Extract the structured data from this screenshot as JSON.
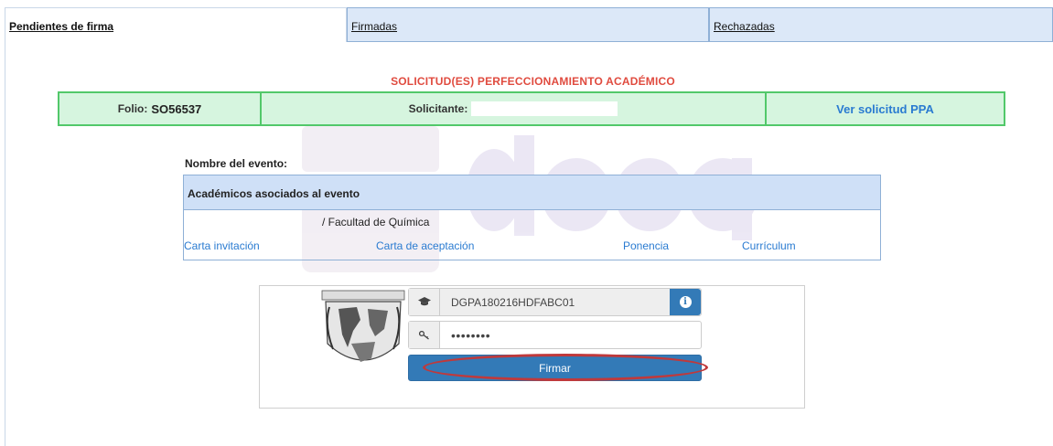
{
  "tabs": [
    {
      "label": "Pendientes de firma",
      "active": true
    },
    {
      "label": "Firmadas",
      "active": false
    },
    {
      "label": "Rechazadas",
      "active": false
    }
  ],
  "section_title": "SOLICITUD(ES) PERFECCIONAMIENTO ACADÉMICO",
  "info": {
    "folio_label": "Folio:",
    "folio_value": "SO56537",
    "solicitante_label": "Solicitante:",
    "ver_link": "Ver solicitud PPA"
  },
  "event": {
    "name_label": "Nombre del evento:",
    "table_header": "Académicos asociados al evento",
    "institution": "/ Facultad de Química",
    "links": [
      "Carta invitación",
      "Carta de aceptación",
      "Ponencia",
      "Currículum"
    ]
  },
  "signature": {
    "certificate": "DGPA180216HDFABC01",
    "password_mask": "••••••••",
    "submit_label": "Firmar"
  },
  "icons": {
    "certificate": "graduation-cap-icon",
    "password": "key-icon",
    "info": "info-circle-icon"
  },
  "colors": {
    "accent_red": "#e04b3f",
    "green_border": "#52c86a",
    "green_bg": "#d6f5df",
    "link_blue": "#2a7bd1",
    "button_blue": "#337ab7",
    "header_blue": "#cfe0f7"
  }
}
